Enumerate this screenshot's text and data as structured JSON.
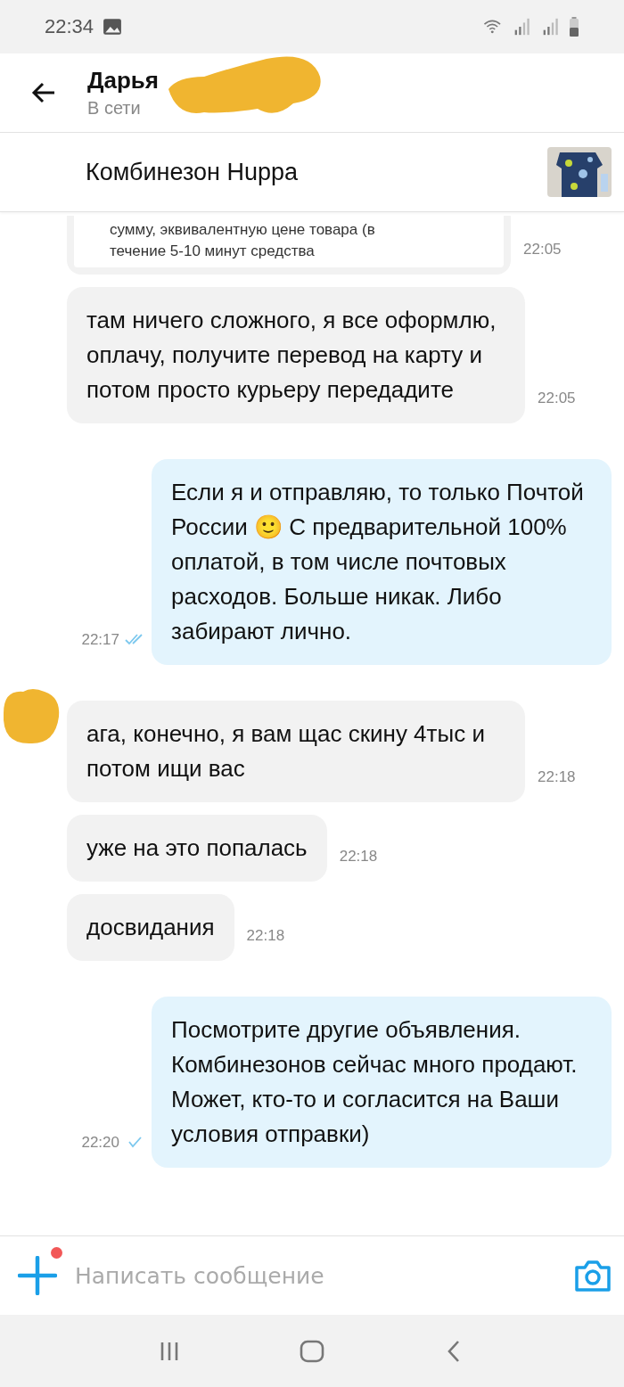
{
  "status_bar": {
    "time": "22:34"
  },
  "header": {
    "name": "Дарья",
    "status": "В сети",
    "name_redacted": true
  },
  "listing": {
    "title": "Комбинезон Huppa"
  },
  "messages": [
    {
      "kind": "quote",
      "lines": [
        "сумму, эквивалентную цене товара (в",
        "течение 5-10 минут средства"
      ],
      "time": "22:05"
    },
    {
      "kind": "incoming",
      "text": "там ничего сложного, я все оформлю, оплачу, получите перевод на карту и потом просто курьеру передадите",
      "time": "22:05"
    },
    {
      "kind": "outgoing",
      "text": "Если я и отправляю, то только Почтой России 🙂 С предварительной 100% оплатой, в том числе почтовых расходов. Больше никак. Либо забирают лично.",
      "time": "22:17",
      "read": true
    },
    {
      "kind": "incoming",
      "text": "ага, конечно, я вам щас скину 4тыс и потом ищи вас",
      "time": "22:18",
      "avatar_redacted": true
    },
    {
      "kind": "incoming",
      "text": "уже на это попалась",
      "time": "22:18"
    },
    {
      "kind": "incoming",
      "text": "досвидания",
      "time": "22:18"
    },
    {
      "kind": "outgoing",
      "text": "Посмотрите другие объявления. Комбинезонов сейчас много продают. Может, кто-то и согласится на Ваши условия отправки)",
      "time": "22:20",
      "read": false
    }
  ],
  "composer": {
    "placeholder": "Написать сообщение",
    "attach_badge": true
  }
}
